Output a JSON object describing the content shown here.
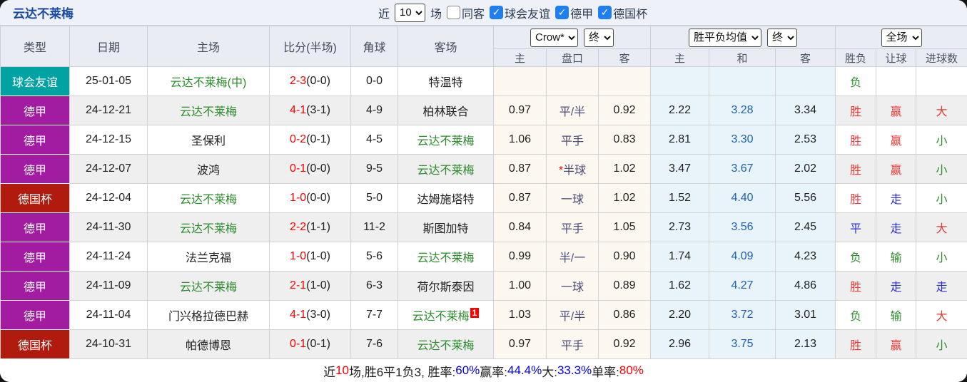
{
  "title": "云达不莱梅",
  "filter_bar": {
    "recent_label": "近",
    "recent_value": "10",
    "matches_label": "场",
    "same_away": {
      "label": "同客",
      "checked": false
    },
    "leagues": [
      {
        "label": "球会友谊",
        "checked": true
      },
      {
        "label": "德甲",
        "checked": true
      },
      {
        "label": "德国杯",
        "checked": true
      }
    ]
  },
  "table": {
    "columns": {
      "type": "类型",
      "date": "日期",
      "home": "主场",
      "score": "比分(半场)",
      "corner": "角球",
      "away": "客场",
      "odds_sub": [
        "主",
        "盘口",
        "客"
      ],
      "mean_sub": [
        "主",
        "和",
        "客"
      ],
      "result_sub": [
        "胜负",
        "让球",
        "进球数"
      ]
    },
    "selects": {
      "company": "Crow*",
      "company_time": "终",
      "mean": "胜平负均值",
      "mean_time": "终",
      "scope": "全场"
    },
    "type_colors": {
      "球会友谊": "#00a2a2",
      "德甲": "#a11ca1",
      "德国杯": "#b11b0e"
    },
    "rows": [
      {
        "type": "球会友谊",
        "date": "25-01-05",
        "home": "云达不莱梅(中)",
        "home_self": true,
        "score": "2-3",
        "half": "(0-0)",
        "corner": "0-0",
        "away": "特温特",
        "away_self": false,
        "away_badge": "",
        "odds_home": "",
        "handicap": "",
        "handicap_star": false,
        "odds_away": "",
        "mean_home": "",
        "mean_draw": "",
        "mean_away": "",
        "result": {
          "text": "负",
          "color": "green"
        },
        "handicap_result": {
          "text": "",
          "color": ""
        },
        "goals_result": {
          "text": "",
          "color": ""
        }
      },
      {
        "type": "德甲",
        "date": "24-12-21",
        "home": "云达不莱梅",
        "home_self": true,
        "score": "4-1",
        "half": "(3-1)",
        "corner": "4-9",
        "away": "柏林联合",
        "away_self": false,
        "away_badge": "",
        "odds_home": "0.97",
        "handicap": "平/半",
        "handicap_star": false,
        "odds_away": "0.92",
        "mean_home": "2.22",
        "mean_draw": "3.28",
        "mean_away": "3.34",
        "result": {
          "text": "胜",
          "color": "red"
        },
        "handicap_result": {
          "text": "赢",
          "color": "red"
        },
        "goals_result": {
          "text": "大",
          "color": "red"
        }
      },
      {
        "type": "德甲",
        "date": "24-12-15",
        "home": "圣保利",
        "home_self": false,
        "score": "0-2",
        "half": "(0-1)",
        "corner": "4-5",
        "away": "云达不莱梅",
        "away_self": true,
        "away_badge": "",
        "odds_home": "1.06",
        "handicap": "平手",
        "handicap_star": false,
        "odds_away": "0.83",
        "mean_home": "2.81",
        "mean_draw": "3.30",
        "mean_away": "2.53",
        "result": {
          "text": "胜",
          "color": "red"
        },
        "handicap_result": {
          "text": "赢",
          "color": "red"
        },
        "goals_result": {
          "text": "小",
          "color": "green"
        }
      },
      {
        "type": "德甲",
        "date": "24-12-07",
        "home": "波鸿",
        "home_self": false,
        "score": "0-1",
        "half": "(0-0)",
        "corner": "9-5",
        "away": "云达不莱梅",
        "away_self": true,
        "away_badge": "",
        "odds_home": "0.87",
        "handicap": "半球",
        "handicap_star": true,
        "odds_away": "1.02",
        "mean_home": "3.47",
        "mean_draw": "3.67",
        "mean_away": "2.02",
        "result": {
          "text": "胜",
          "color": "red"
        },
        "handicap_result": {
          "text": "赢",
          "color": "red"
        },
        "goals_result": {
          "text": "小",
          "color": "green"
        }
      },
      {
        "type": "德国杯",
        "date": "24-12-04",
        "home": "云达不莱梅",
        "home_self": true,
        "score": "1-0",
        "half": "(0-0)",
        "corner": "5-0",
        "away": "达姆施塔特",
        "away_self": false,
        "away_badge": "",
        "odds_home": "0.87",
        "handicap": "一球",
        "handicap_star": false,
        "odds_away": "1.02",
        "mean_home": "1.52",
        "mean_draw": "4.40",
        "mean_away": "5.56",
        "result": {
          "text": "胜",
          "color": "red"
        },
        "handicap_result": {
          "text": "走",
          "color": "blue"
        },
        "goals_result": {
          "text": "小",
          "color": "green"
        }
      },
      {
        "type": "德甲",
        "date": "24-11-30",
        "home": "云达不莱梅",
        "home_self": true,
        "score": "2-2",
        "half": "(1-1)",
        "corner": "11-2",
        "away": "斯图加特",
        "away_self": false,
        "away_badge": "",
        "odds_home": "0.84",
        "handicap": "平手",
        "handicap_star": false,
        "odds_away": "1.05",
        "mean_home": "2.73",
        "mean_draw": "3.56",
        "mean_away": "2.45",
        "result": {
          "text": "平",
          "color": "blue"
        },
        "handicap_result": {
          "text": "走",
          "color": "blue"
        },
        "goals_result": {
          "text": "大",
          "color": "red"
        }
      },
      {
        "type": "德甲",
        "date": "24-11-24",
        "home": "法兰克福",
        "home_self": false,
        "score": "1-0",
        "half": "(1-0)",
        "corner": "5-6",
        "away": "云达不莱梅",
        "away_self": true,
        "away_badge": "",
        "odds_home": "0.99",
        "handicap": "半/一",
        "handicap_star": false,
        "odds_away": "0.90",
        "mean_home": "1.74",
        "mean_draw": "4.09",
        "mean_away": "4.23",
        "result": {
          "text": "负",
          "color": "green"
        },
        "handicap_result": {
          "text": "输",
          "color": "green"
        },
        "goals_result": {
          "text": "小",
          "color": "green"
        }
      },
      {
        "type": "德甲",
        "date": "24-11-09",
        "home": "云达不莱梅",
        "home_self": true,
        "score": "2-1",
        "half": "(1-0)",
        "corner": "6-3",
        "away": "荷尔斯泰因",
        "away_self": false,
        "away_badge": "",
        "odds_home": "1.00",
        "handicap": "一球",
        "handicap_star": false,
        "odds_away": "0.89",
        "mean_home": "1.62",
        "mean_draw": "4.27",
        "mean_away": "4.86",
        "result": {
          "text": "胜",
          "color": "red"
        },
        "handicap_result": {
          "text": "走",
          "color": "blue"
        },
        "goals_result": {
          "text": "走",
          "color": "blue"
        }
      },
      {
        "type": "德甲",
        "date": "24-11-04",
        "home": "门兴格拉德巴赫",
        "home_self": false,
        "score": "4-1",
        "half": "(3-0)",
        "corner": "7-7",
        "away": "云达不莱梅",
        "away_self": true,
        "away_badge": "1",
        "odds_home": "1.03",
        "handicap": "平/半",
        "handicap_star": false,
        "odds_away": "0.86",
        "mean_home": "2.20",
        "mean_draw": "3.72",
        "mean_away": "3.01",
        "result": {
          "text": "负",
          "color": "green"
        },
        "handicap_result": {
          "text": "输",
          "color": "green"
        },
        "goals_result": {
          "text": "大",
          "color": "red"
        }
      },
      {
        "type": "德国杯",
        "date": "24-10-31",
        "home": "帕德博恩",
        "home_self": false,
        "score": "0-1",
        "half": "(0-1)",
        "corner": "7-6",
        "away": "云达不莱梅",
        "away_self": true,
        "away_badge": "",
        "odds_home": "0.97",
        "handicap": "平手",
        "handicap_star": false,
        "odds_away": "0.92",
        "mean_home": "2.96",
        "mean_draw": "3.75",
        "mean_away": "2.13",
        "result": {
          "text": "胜",
          "color": "red"
        },
        "handicap_result": {
          "text": "赢",
          "color": "red"
        },
        "goals_result": {
          "text": "小",
          "color": "green"
        }
      }
    ]
  },
  "summary": {
    "segments": [
      {
        "text": "近",
        "color": "black"
      },
      {
        "text": "10",
        "color": "red"
      },
      {
        "text": "场,胜6平1负3, 胜率:",
        "color": "black"
      },
      {
        "text": "60%",
        "color": "blue"
      },
      {
        "text": " 赢率:",
        "color": "black"
      },
      {
        "text": "44.4%",
        "color": "blue"
      },
      {
        "text": " 大:",
        "color": "black"
      },
      {
        "text": "33.3%",
        "color": "blue"
      },
      {
        "text": " 单率:",
        "color": "black"
      },
      {
        "text": "80%",
        "color": "red"
      }
    ]
  }
}
